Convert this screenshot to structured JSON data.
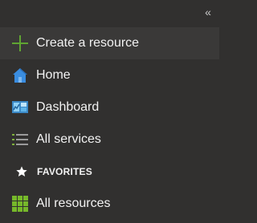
{
  "sidebar": {
    "collapse_glyph": "«",
    "items": [
      {
        "label": "Create a resource",
        "icon": "plus-icon"
      },
      {
        "label": "Home",
        "icon": "home-icon"
      },
      {
        "label": "Dashboard",
        "icon": "dashboard-icon"
      },
      {
        "label": "All services",
        "icon": "list-icon"
      }
    ],
    "favorites": {
      "label": "FAVORITES",
      "icon": "star-icon"
    },
    "favorite_items": [
      {
        "label": "All resources",
        "icon": "grid-icon"
      }
    ]
  },
  "colors": {
    "background": "#31302f",
    "highlight_row": "#3a3938",
    "plus_green": "#5fa532",
    "home_blue": "#3a8de0",
    "grid_green": "#76b82a"
  }
}
